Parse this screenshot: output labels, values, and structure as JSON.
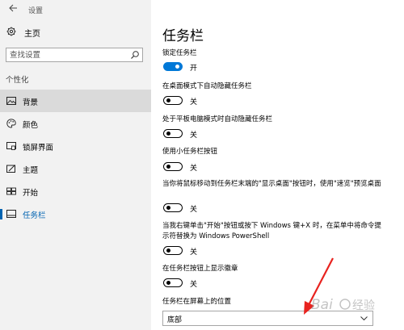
{
  "app": {
    "title": "设置"
  },
  "sidebar": {
    "home_label": "主页",
    "search_placeholder": "查找设置",
    "section_title": "个性化",
    "items": [
      {
        "label": "背景",
        "icon": "picture-icon",
        "selected": true,
        "active": false
      },
      {
        "label": "颜色",
        "icon": "palette-icon",
        "selected": false,
        "active": false
      },
      {
        "label": "锁屏界面",
        "icon": "lock-screen-icon",
        "selected": false,
        "active": false
      },
      {
        "label": "主题",
        "icon": "theme-icon",
        "selected": false,
        "active": false
      },
      {
        "label": "开始",
        "icon": "start-icon",
        "selected": false,
        "active": false
      },
      {
        "label": "任务栏",
        "icon": "taskbar-icon",
        "selected": false,
        "active": true
      }
    ]
  },
  "main": {
    "title": "任务栏",
    "settings": [
      {
        "label": "锁定任务栏",
        "on": true,
        "state_label": "开"
      },
      {
        "label": "在桌面模式下自动隐藏任务栏",
        "on": false,
        "state_label": "关"
      },
      {
        "label": "处于平板电脑模式时自动隐藏任务栏",
        "on": false,
        "state_label": "关"
      },
      {
        "label": "使用小任务栏按钮",
        "on": false,
        "state_label": "关"
      },
      {
        "label": "当你将鼠标移动到任务栏末端的\"显示桌面\"按钮时，使用\"速览\"预览桌面",
        "on": false,
        "state_label": "关"
      },
      {
        "label": "当我右键单击\"开始\"按钮或按下 Windows 键+X 时，在菜单中将命令提示符替换为 Windows PowerShell",
        "on": false,
        "state_label": "关"
      },
      {
        "label": "在任务栏按钮上显示徽章",
        "on": false,
        "state_label": "关"
      }
    ],
    "position_label": "任务栏在屏幕上的位置",
    "position_value": "底部"
  },
  "colors": {
    "accent": "#0078d7",
    "nav_active": "#0063b1",
    "sidebar_bg": "#f2f2f2",
    "selected_bg": "#dadada",
    "annotation": "#e8231f"
  },
  "watermark": {
    "text": "Baidu经验"
  }
}
